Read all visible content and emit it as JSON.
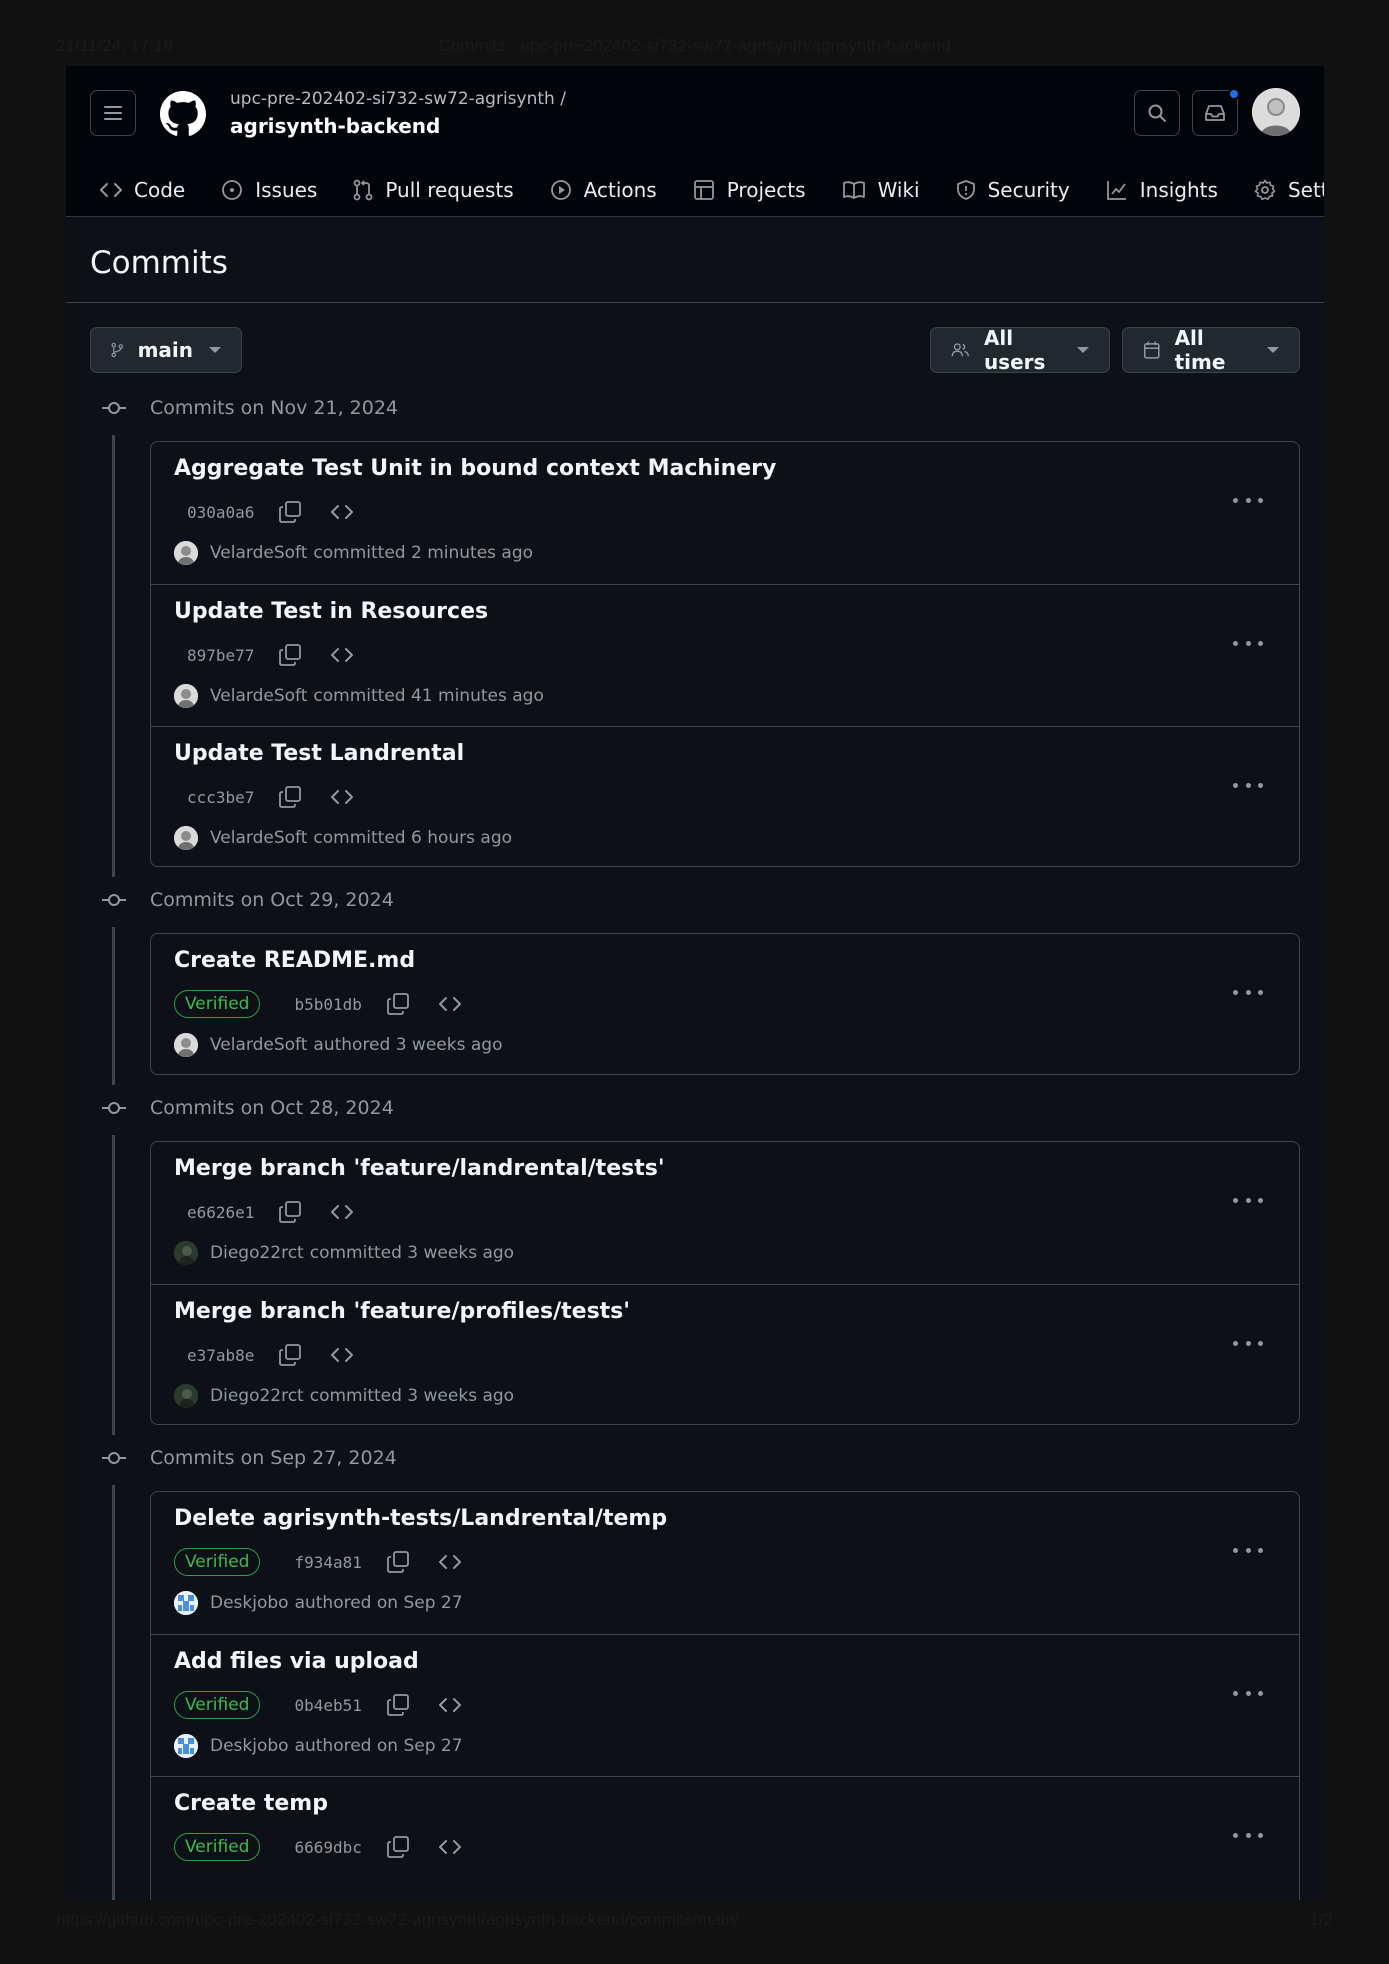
{
  "print": {
    "datetime": "21/11/24, 17:18",
    "page_title": "Commits · upc-pre-202402-si732-sw72-agrisynth/agrisynth-backend",
    "url": "https://github.com/upc-pre-202402-si732-sw72-agrisynth/agrisynth-backend/commits/main/",
    "page_number": "1/2"
  },
  "header": {
    "repo_owner": "upc-pre-202402-si732-sw72-agrisynth /",
    "repo_name": "agrisynth-backend"
  },
  "nav": {
    "items": [
      {
        "label": "Code",
        "icon": "code-icon"
      },
      {
        "label": "Issues",
        "icon": "issue-icon"
      },
      {
        "label": "Pull requests",
        "icon": "pull-request-icon"
      },
      {
        "label": "Actions",
        "icon": "play-icon"
      },
      {
        "label": "Projects",
        "icon": "table-icon"
      },
      {
        "label": "Wiki",
        "icon": "book-icon"
      },
      {
        "label": "Security",
        "icon": "shield-icon"
      },
      {
        "label": "Insights",
        "icon": "graph-icon"
      },
      {
        "label": "Settin",
        "icon": "gear-icon"
      }
    ]
  },
  "page": {
    "title": "Commits"
  },
  "toolbar": {
    "branch": "main",
    "users_filter": "All users",
    "time_filter": "All time"
  },
  "days": [
    {
      "label": "Commits on Nov 21, 2024",
      "commits": [
        {
          "title": "Aggregate Test Unit in bound context Machinery",
          "sha": "030a0a6",
          "verified": false,
          "author": "VelardeSoft",
          "action": "committed 2 minutes ago",
          "avatar": "velarde"
        },
        {
          "title": "Update Test in Resources",
          "sha": "897be77",
          "verified": false,
          "author": "VelardeSoft",
          "action": "committed 41 minutes ago",
          "avatar": "velarde"
        },
        {
          "title": "Update Test Landrental",
          "sha": "ccc3be7",
          "verified": false,
          "author": "VelardeSoft",
          "action": "committed 6 hours ago",
          "avatar": "velarde"
        }
      ]
    },
    {
      "label": "Commits on Oct 29, 2024",
      "commits": [
        {
          "title": "Create README.md",
          "sha": "b5b01db",
          "verified": true,
          "author": "VelardeSoft",
          "action": "authored 3 weeks ago",
          "avatar": "velarde"
        }
      ]
    },
    {
      "label": "Commits on Oct 28, 2024",
      "commits": [
        {
          "title": "Merge branch 'feature/landrental/tests'",
          "sha": "e6626e1",
          "verified": false,
          "author": "Diego22rct",
          "action": "committed 3 weeks ago",
          "avatar": "diego"
        },
        {
          "title": "Merge branch 'feature/profiles/tests'",
          "sha": "e37ab8e",
          "verified": false,
          "author": "Diego22rct",
          "action": "committed 3 weeks ago",
          "avatar": "diego"
        }
      ]
    },
    {
      "label": "Commits on Sep 27, 2024",
      "commits": [
        {
          "title": "Delete agrisynth-tests/Landrental/temp",
          "sha": "f934a81",
          "verified": true,
          "author": "Deskjobo",
          "action": "authored on Sep 27",
          "avatar": "desk"
        },
        {
          "title": "Add files via upload",
          "sha": "0b4eb51",
          "verified": true,
          "author": "Deskjobo",
          "action": "authored on Sep 27",
          "avatar": "desk"
        },
        {
          "title": "Create temp",
          "sha": "6669dbc",
          "verified": true,
          "author": "",
          "action": "",
          "avatar": ""
        }
      ]
    }
  ],
  "labels": {
    "verified": "Verified"
  },
  "colors": {
    "background": "#0d1117",
    "header_bg": "#010409",
    "border": "#3d444d",
    "accent_blue": "#1f6feb",
    "verified_green": "#3fb950"
  }
}
